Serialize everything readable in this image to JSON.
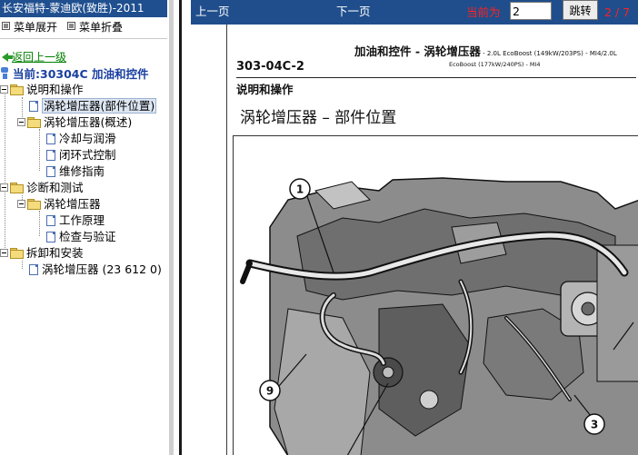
{
  "left": {
    "app_title": "长安福特-蒙迪欧(致胜)-2011",
    "menu": {
      "expand": "菜单展开",
      "collapse": "菜单折叠"
    },
    "back": "返回上一级",
    "current": "当前:30304C 加油和控件",
    "tree": [
      {
        "label": "说明和操作"
      },
      {
        "label": "涡轮增压器(部件位置)",
        "selected": true
      },
      {
        "label": "涡轮增压器(概述)"
      },
      {
        "label": "冷却与润滑"
      },
      {
        "label": "闭环式控制"
      },
      {
        "label": "维修指南"
      },
      {
        "label": "诊断和测试"
      },
      {
        "label": "涡轮增压器"
      },
      {
        "label": "工作原理"
      },
      {
        "label": "检查与验证"
      },
      {
        "label": "拆卸和安装"
      },
      {
        "label": "涡轮增压器 (23 612 0)"
      }
    ]
  },
  "nav": {
    "prev": "上一页",
    "next": "下一页",
    "page_label": "当前为",
    "page_value": "2",
    "go": "跳转",
    "page_count": "2 / 7"
  },
  "doc": {
    "header": "加油和控件 - 涡轮增压器",
    "header_sub": " - 2.0L EcoBoost (149kW/203PS) - MI4/2.0L",
    "header_sub2": "EcoBoost (177kW/240PS) - MI4",
    "section_num": "303-04C-2",
    "section_head": "说明和操作",
    "page_title": "涡轮增压器 – 部件位置",
    "callouts": [
      "1",
      "9",
      "3"
    ]
  },
  "colors": {
    "title_bar": "#1f4f8f",
    "nav_bar": "#204e8c",
    "current": "#1a3fa0",
    "back_link": "#008000",
    "page_red": "#ff2020"
  }
}
